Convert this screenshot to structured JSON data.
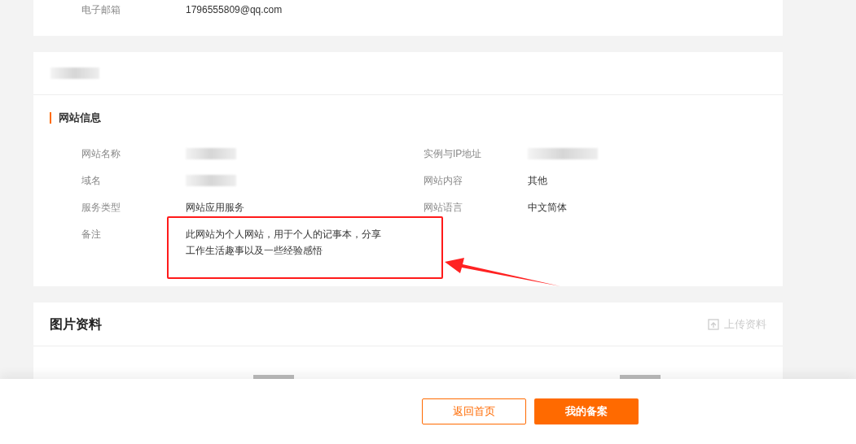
{
  "contact": {
    "rows": [
      {
        "label": "电子邮箱",
        "value": "1796555809@qq.com"
      }
    ]
  },
  "site_card": {
    "header": {
      "kind": "redacted"
    },
    "section_title": "网站信息",
    "fields": [
      {
        "label": "网站名称",
        "kind": "redacted"
      },
      {
        "label": "实例与IP地址",
        "kind": "redacted"
      },
      {
        "label": "域名",
        "kind": "redacted"
      },
      {
        "label": "网站内容",
        "kind": "text",
        "value": "其他"
      },
      {
        "label": "服务类型",
        "kind": "text",
        "value": "网站应用服务"
      },
      {
        "label": "网站语言",
        "kind": "text",
        "value": "中文简体"
      },
      {
        "label": "备注",
        "kind": "text",
        "value": "此网站为个人网站，用于个人的记事本，分享工作生活趣事以及一些经验感悟",
        "highlighted": true
      }
    ]
  },
  "images_card": {
    "title": "图片资料",
    "upload_button": {
      "label": "上传资料",
      "disabled": true
    }
  },
  "footer": {
    "buttons": [
      {
        "label": "返回首页",
        "kind": "outline"
      },
      {
        "label": "我的备案",
        "kind": "primary"
      }
    ]
  }
}
